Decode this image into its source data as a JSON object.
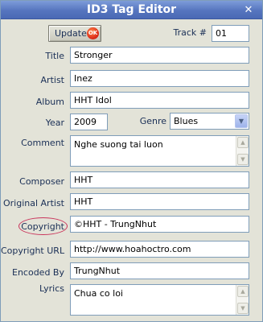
{
  "window": {
    "title": "ID3 Tag Editor",
    "close_glyph": "✕"
  },
  "toolbar": {
    "update_label": "Update",
    "ok_badge": "OK",
    "track_label": "Track #",
    "track_value": "01"
  },
  "fields": {
    "title": {
      "label": "Title",
      "value": "Stronger"
    },
    "artist": {
      "label": "Artist",
      "value": "Inez"
    },
    "album": {
      "label": "Album",
      "value": "HHT Idol"
    },
    "year": {
      "label": "Year",
      "value": "2009"
    },
    "genre": {
      "label": "Genre",
      "value": "Blues"
    },
    "comment": {
      "label": "Comment",
      "value": "Nghe suong tai luon"
    },
    "composer": {
      "label": "Composer",
      "value": "HHT"
    },
    "original_artist": {
      "label": "Original Artist",
      "value": "HHT"
    },
    "copyright": {
      "label": "Copyright",
      "value": "©HHT - TrungNhut"
    },
    "copyright_url": {
      "label": "Copyright URL",
      "value": "http://www.hoahoctro.com"
    },
    "encoded_by": {
      "label": "Encoded By",
      "value": "TrungNhut"
    },
    "lyrics": {
      "label": "Lyrics",
      "value": "Chua co loi"
    }
  },
  "icons": {
    "scroll_up": "chevron-up-icon",
    "scroll_down": "chevron-down-icon",
    "dropdown": "chevron-down-icon"
  },
  "colors": {
    "titlebar": "#5675bf",
    "window_bg": "#e3e3d8",
    "label_text": "#1a2f56",
    "highlight_circle": "#c9335a",
    "ok_badge": "#e0301a"
  }
}
